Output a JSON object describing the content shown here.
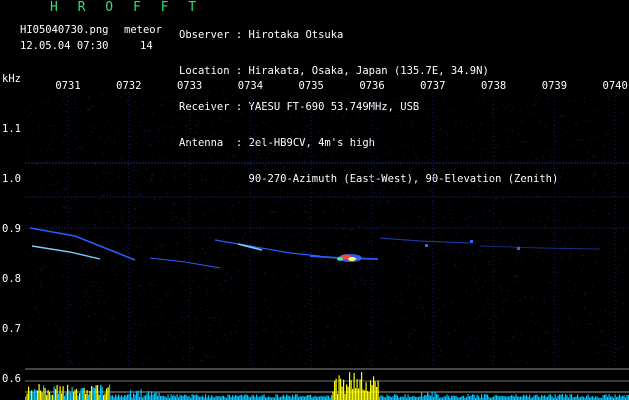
{
  "app": {
    "title": "H R O F F T"
  },
  "file": {
    "name": "HI05040730.png",
    "meteor_label": "meteor",
    "date_time": "12.05.04 07:30",
    "meteor_count": "14"
  },
  "info": {
    "observer_label": "Observer",
    "observer": "Hirotaka Otsuka",
    "location_label": "Location",
    "location": "Hirakata, Osaka, Japan (135.7E, 34.9N)",
    "receiver_label": "Receiver",
    "receiver": "YAESU FT-690 53.749MHz, USB",
    "antenna_label": "Antenna",
    "antenna": "2el-HB9CV, 4m's high",
    "antenna_detail": "90-270-Azimuth (East-West), 90-Elevation (Zenith)"
  },
  "axis": {
    "freq_unit": "kHz",
    "time_ticks": [
      "0731",
      "0732",
      "0733",
      "0734",
      "0735",
      "0736",
      "0737",
      "0738",
      "0739",
      "0740"
    ],
    "freq_ticks": [
      "1.1",
      "1.0",
      "0.9",
      "0.8",
      "0.7",
      "0.6"
    ]
  },
  "colors": {
    "background": "#000000",
    "title_green": "#31e07a",
    "trace_blue": "#2a5cff",
    "trace_cyan": "#7fd0ff",
    "echo_yellow": "#ffff00",
    "echo_cyan": "#00c8ff",
    "guide_line": "#9a9a9a"
  }
}
